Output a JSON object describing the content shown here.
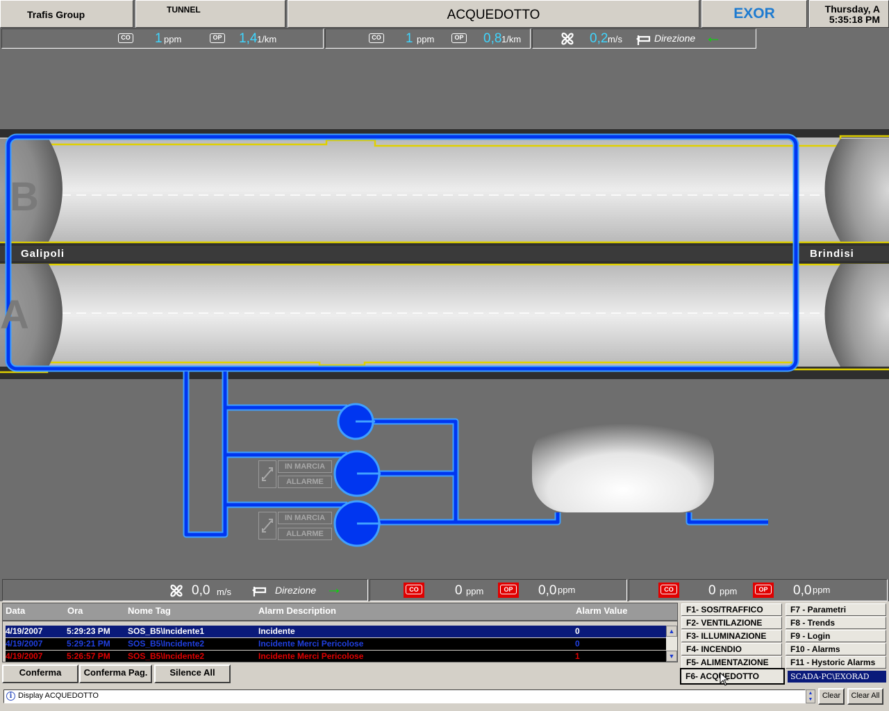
{
  "header": {
    "company": "Trafis Group",
    "section": "TUNNEL",
    "page_title": "ACQUEDOTTO",
    "brand": "EXOR",
    "date_line": "Thursday, A",
    "time_line": "5:35:18 PM"
  },
  "top_bar": {
    "g1": {
      "co_badge": "CO",
      "co_value": "1",
      "co_unit": "ppm",
      "op_badge": "OP",
      "op_value": "1,4",
      "op_unit": "1/km"
    },
    "g2": {
      "co_badge": "CO",
      "co_value": "1",
      "co_unit": "ppm",
      "op_badge": "OP",
      "op_value": "0,8",
      "op_unit": "1/km"
    },
    "wind": {
      "value": "0,2",
      "unit": "m/s",
      "direction_label": "Direzione",
      "direction_arrow": "←"
    }
  },
  "tunnel": {
    "tube_b": "B",
    "tube_a": "A",
    "west_label": "Galipoli",
    "east_label": "Brindisi"
  },
  "pumps": [
    {
      "status_run": "IN MARCIA",
      "status_alarm": "ALLARME"
    },
    {
      "status_run": "IN MARCIA",
      "status_alarm": "ALLARME"
    }
  ],
  "bottom_bar": {
    "wind": {
      "value": "0,0",
      "unit": "m/s",
      "direction_label": "Direzione",
      "direction_arrow": "→"
    },
    "g1": {
      "co_badge": "CO",
      "co_value": "0",
      "co_unit": "ppm",
      "op_badge": "OP",
      "op_value": "0,0",
      "op_unit": "ppm"
    },
    "g2": {
      "co_badge": "CO",
      "co_value": "0",
      "co_unit": "ppm",
      "op_badge": "OP",
      "op_value": "0,0",
      "op_unit": "ppm"
    }
  },
  "alarms": {
    "columns": [
      "Data",
      "Ora",
      "Nome Tag",
      "Alarm Description",
      "Alarm Value"
    ],
    "rows": [
      {
        "date": "4/19/2007",
        "time": "5:29:23 PM",
        "tag": "SOS_B5\\Incidente1",
        "desc": "Incidente",
        "value": "0"
      },
      {
        "date": "4/19/2007",
        "time": "5:29:21 PM",
        "tag": "SOS_B5\\Incidente2",
        "desc": "Incidente Merci Pericolose",
        "value": "0"
      },
      {
        "date": "4/19/2007",
        "time": "5:26:57 PM",
        "tag": "SOS_B5\\Incidente2",
        "desc": "Incidente Merci Pericolose",
        "value": "1"
      }
    ],
    "buttons": {
      "confirm": "Conferma",
      "confirm_page": "Conferma Pag.",
      "silence": "Silence All"
    }
  },
  "fkeys": {
    "left": [
      "F1- SOS/TRAFFICO",
      "F2- VENTILAZIONE",
      "F3- ILLUMINAZIONE",
      "F4- INCENDIO",
      "F5- ALIMENTAZIONE",
      "F6- ACQUEDOTTO"
    ],
    "right": [
      "F7 - Parametri",
      "F8 - Trends",
      "F9 - Login",
      "F10 - Alarms",
      "F11 - Hystoric Alarms"
    ],
    "user": "SCADA-PC\\EXORAD"
  },
  "status_bar": {
    "message": "Display ACQUEDOTTO",
    "clear": "Clear",
    "clear_all": "Clear All"
  },
  "colors": {
    "pipe": "#0040ff",
    "pipe_glow": "#40a0ff",
    "value_cyan": "#3fd6ff",
    "arrow_green": "#00e000",
    "alarm_sel_bg": "#0a1a7a",
    "alarm_blue": "#1030c0",
    "alarm_red": "#e00000",
    "tunnel_line": "#e0d000"
  }
}
